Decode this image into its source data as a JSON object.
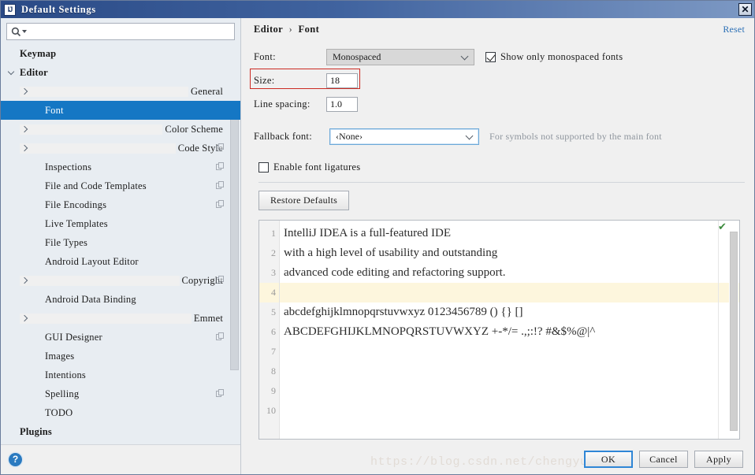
{
  "window": {
    "title": "Default Settings",
    "app_icon": "IJ",
    "close_icon": "close-icon",
    "close_label": "✕"
  },
  "sidebar": {
    "search": {
      "placeholder": "",
      "value": "",
      "icon": "search-icon"
    },
    "items": [
      {
        "label": "Keymap",
        "indent": 0,
        "arrow": "none",
        "bold": true,
        "selected": false,
        "copy": false
      },
      {
        "label": "Editor",
        "indent": 0,
        "arrow": "down",
        "bold": true,
        "selected": false,
        "copy": false
      },
      {
        "label": "General",
        "indent": 1,
        "arrow": "right",
        "bold": false,
        "selected": false,
        "copy": false
      },
      {
        "label": "Font",
        "indent": 2,
        "arrow": "none",
        "bold": false,
        "selected": true,
        "copy": false
      },
      {
        "label": "Color Scheme",
        "indent": 1,
        "arrow": "right",
        "bold": false,
        "selected": false,
        "copy": false
      },
      {
        "label": "Code Style",
        "indent": 1,
        "arrow": "right",
        "bold": false,
        "selected": false,
        "copy": true
      },
      {
        "label": "Inspections",
        "indent": 2,
        "arrow": "none",
        "bold": false,
        "selected": false,
        "copy": true
      },
      {
        "label": "File and Code Templates",
        "indent": 2,
        "arrow": "none",
        "bold": false,
        "selected": false,
        "copy": true
      },
      {
        "label": "File Encodings",
        "indent": 2,
        "arrow": "none",
        "bold": false,
        "selected": false,
        "copy": true
      },
      {
        "label": "Live Templates",
        "indent": 2,
        "arrow": "none",
        "bold": false,
        "selected": false,
        "copy": false
      },
      {
        "label": "File Types",
        "indent": 2,
        "arrow": "none",
        "bold": false,
        "selected": false,
        "copy": false
      },
      {
        "label": "Android Layout Editor",
        "indent": 2,
        "arrow": "none",
        "bold": false,
        "selected": false,
        "copy": false
      },
      {
        "label": "Copyright",
        "indent": 1,
        "arrow": "right",
        "bold": false,
        "selected": false,
        "copy": true
      },
      {
        "label": "Android Data Binding",
        "indent": 2,
        "arrow": "none",
        "bold": false,
        "selected": false,
        "copy": false
      },
      {
        "label": "Emmet",
        "indent": 1,
        "arrow": "right",
        "bold": false,
        "selected": false,
        "copy": false
      },
      {
        "label": "GUI Designer",
        "indent": 2,
        "arrow": "none",
        "bold": false,
        "selected": false,
        "copy": true
      },
      {
        "label": "Images",
        "indent": 2,
        "arrow": "none",
        "bold": false,
        "selected": false,
        "copy": false
      },
      {
        "label": "Intentions",
        "indent": 2,
        "arrow": "none",
        "bold": false,
        "selected": false,
        "copy": false
      },
      {
        "label": "Spelling",
        "indent": 2,
        "arrow": "none",
        "bold": false,
        "selected": false,
        "copy": true
      },
      {
        "label": "TODO",
        "indent": 2,
        "arrow": "none",
        "bold": false,
        "selected": false,
        "copy": false
      },
      {
        "label": "Plugins",
        "indent": 0,
        "arrow": "none",
        "bold": true,
        "selected": false,
        "copy": false
      }
    ],
    "help_label": "?"
  },
  "header": {
    "breadcrumb_root": "Editor",
    "breadcrumb_sep": "›",
    "breadcrumb_leaf": "Font",
    "reset_label": "Reset"
  },
  "form": {
    "font_label": "Font:",
    "font_value": "Monospaced",
    "show_monospaced_label": "Show only monospaced fonts",
    "show_monospaced_checked": true,
    "size_label": "Size:",
    "size_value": "18",
    "line_spacing_label": "Line spacing:",
    "line_spacing_value": "1.0",
    "fallback_label": "Fallback font:",
    "fallback_value": "‹None›",
    "fallback_hint": "For symbols not supported by the main font",
    "ligatures_label": "Enable font ligatures",
    "ligatures_checked": false,
    "restore_defaults_label": "Restore Defaults"
  },
  "preview": {
    "lines": [
      {
        "num": "1",
        "text": "IntelliJ IDEA is a full-featured IDE",
        "highlight": false
      },
      {
        "num": "2",
        "text": "with a high level of usability and outstanding",
        "highlight": false
      },
      {
        "num": "3",
        "text": "advanced code editing and refactoring support.",
        "highlight": false
      },
      {
        "num": "4",
        "text": "",
        "highlight": true
      },
      {
        "num": "5",
        "text": "abcdefghijklmnopqrstuvwxyz 0123456789 () {} []",
        "highlight": false
      },
      {
        "num": "6",
        "text": "ABCDEFGHIJKLMNOPQRSTUVWXYZ +-*/= .,;:!? #&$%@|^",
        "highlight": false
      },
      {
        "num": "7",
        "text": "",
        "highlight": false
      },
      {
        "num": "8",
        "text": "",
        "highlight": false
      },
      {
        "num": "9",
        "text": "",
        "highlight": false
      },
      {
        "num": "10",
        "text": "",
        "highlight": false
      }
    ],
    "inspection_badge": "✔"
  },
  "footer": {
    "ok_label": "OK",
    "cancel_label": "Cancel",
    "apply_label": "Apply",
    "watermark": "https://blog.csdn.net/chengyuqiang"
  },
  "colors": {
    "selection": "#1577c4",
    "title_bar": "#2a4a86",
    "highlight_box": "#cc2a22",
    "link": "#2b6fb5",
    "line_highlight": "#fdf6dd"
  }
}
